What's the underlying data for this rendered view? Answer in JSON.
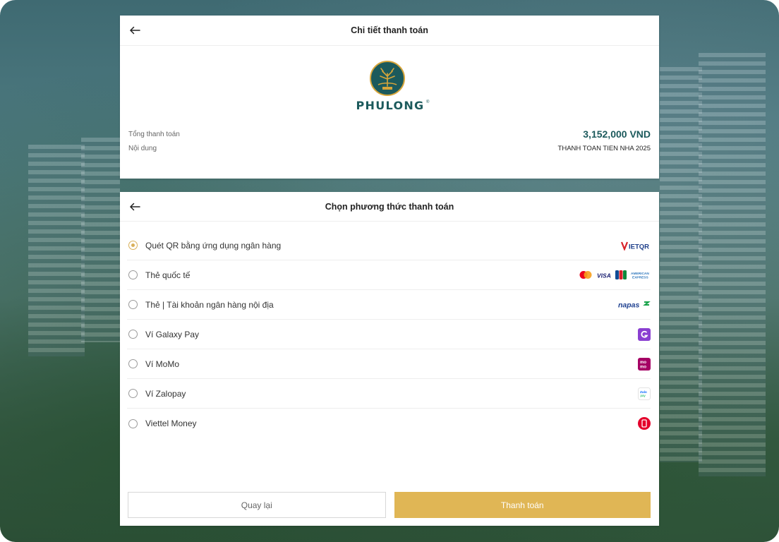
{
  "colors": {
    "accent": "#1c5a5c",
    "gold": "#e0b655",
    "radio_selected": "#d9b05a"
  },
  "payment_details": {
    "title": "Chi tiết thanh toán",
    "back_icon": "arrow-left-icon",
    "brand": "PHULONG",
    "brand_mark": "®",
    "total_label": "Tổng thanh toán",
    "total_value": "3,152,000 VND",
    "content_label": "Nội dung",
    "content_value": "THANH TOAN TIEN NHA 2025"
  },
  "payment_methods": {
    "title": "Chọn phương thức thanh toán",
    "back_icon": "arrow-left-icon",
    "selected_index": 0,
    "items": [
      {
        "label": "Quét QR bằng ứng dụng ngân hàng",
        "logo": "vietqr-logo",
        "logo_text": "VIETQR"
      },
      {
        "label": "Thẻ quốc tế",
        "logo": "card-brands-logo",
        "logo_text": "VISA"
      },
      {
        "label": "Thẻ | Tài khoản ngân hàng nội địa",
        "logo": "napas-logo",
        "logo_text": "napas"
      },
      {
        "label": "Ví Galaxy Pay",
        "logo": "galaxy-pay-logo",
        "logo_text": "G"
      },
      {
        "label": "Ví MoMo",
        "logo": "momo-logo",
        "logo_text": "mo mo"
      },
      {
        "label": "Ví Zalopay",
        "logo": "zalopay-logo",
        "logo_text": "Zalo pay"
      },
      {
        "label": "Viettel Money",
        "logo": "viettel-money-logo",
        "logo_text": ""
      }
    ]
  },
  "buttons": {
    "back_label": "Quay lại",
    "pay_label": "Thanh toán"
  }
}
